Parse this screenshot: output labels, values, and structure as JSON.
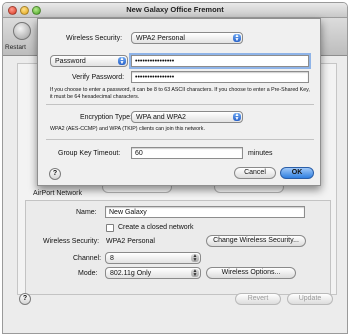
{
  "window": {
    "title": "New Galaxy Office Fremont"
  },
  "toolbar": {
    "restart_label": "Restart"
  },
  "sheet": {
    "wireless_security_label": "Wireless Security:",
    "wireless_security_value": "WPA2 Personal",
    "password_type_value": "Password",
    "password_value": "••••••••••••••••",
    "verify_label": "Verify Password:",
    "verify_value": "••••••••••••••••",
    "password_note": "If you choose to enter a password, it can be 8 to 63 ASCII characters. If you choose to enter a Pre-Shared Key, it must be 64 hexadecimal characters.",
    "encryption_label": "Encryption Type:",
    "encryption_value": "WPA and WPA2",
    "encryption_note": "WPA2 (AES-CCMP) and WPA (TKIP) clients can join this network.",
    "group_key_label": "Group Key Timeout:",
    "group_key_value": "60",
    "group_key_unit": "minutes",
    "help_label": "?",
    "cancel_label": "Cancel",
    "ok_label": "OK"
  },
  "pane": {
    "section_title": "AirPort Network",
    "name_label": "Name:",
    "name_value": "New Galaxy",
    "closed_network_label": "Create a closed network",
    "wireless_security_label": "Wireless Security:",
    "wireless_security_value": "WPA2 Personal",
    "change_security_button": "Change Wireless Security...",
    "channel_label": "Channel:",
    "channel_value": "8",
    "mode_label": "Mode:",
    "mode_value": "802.11g Only",
    "wireless_options_button": "Wireless Options...",
    "help_label": "?",
    "revert_label": "Revert",
    "update_label": "Update"
  },
  "colors": {
    "accent": "#2f7fe0",
    "focus_ring": "#8fb4e8"
  },
  "icons": {
    "restart": "restart-icon",
    "popup_arrows": "popup-arrows-icon",
    "help": "help-icon"
  }
}
